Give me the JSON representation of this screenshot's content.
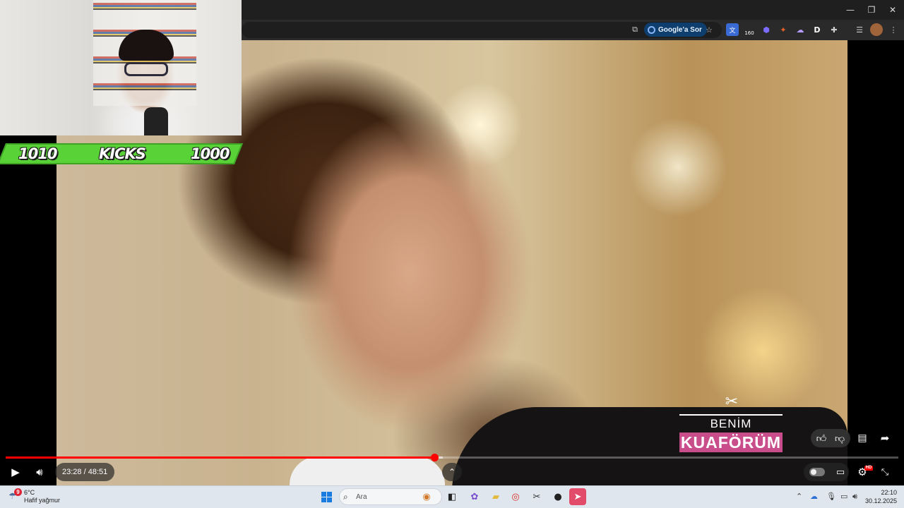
{
  "browser": {
    "window_controls": {
      "minimize": "—",
      "restore": "❐",
      "close": "✕"
    },
    "toolbar": {
      "ask_google_label": "Google'a Sor",
      "extension_counter": "160"
    }
  },
  "webcam_overlay": {
    "kicks_left": "1010",
    "kicks_label": "KICKS",
    "kicks_right": "1000",
    "bar_color": "#58d237"
  },
  "video": {
    "channel_brand_top": "BENİM",
    "channel_brand_bottom": "KUAFÖRÜM",
    "brand_color": "#c84d8a"
  },
  "player": {
    "current_time": "23:28",
    "separator": " / ",
    "duration": "48:51",
    "progress_fraction": 0.48,
    "buffered_fraction": 0.49,
    "accent": "#ff0000",
    "hd_badge": "HD"
  },
  "taskbar": {
    "weather_alert_count": "9",
    "weather_temp": "6°C",
    "weather_desc": "Hafif yağmur",
    "search_placeholder": "Ara",
    "clock_time": "22:10",
    "clock_date": "30.12.2025"
  }
}
